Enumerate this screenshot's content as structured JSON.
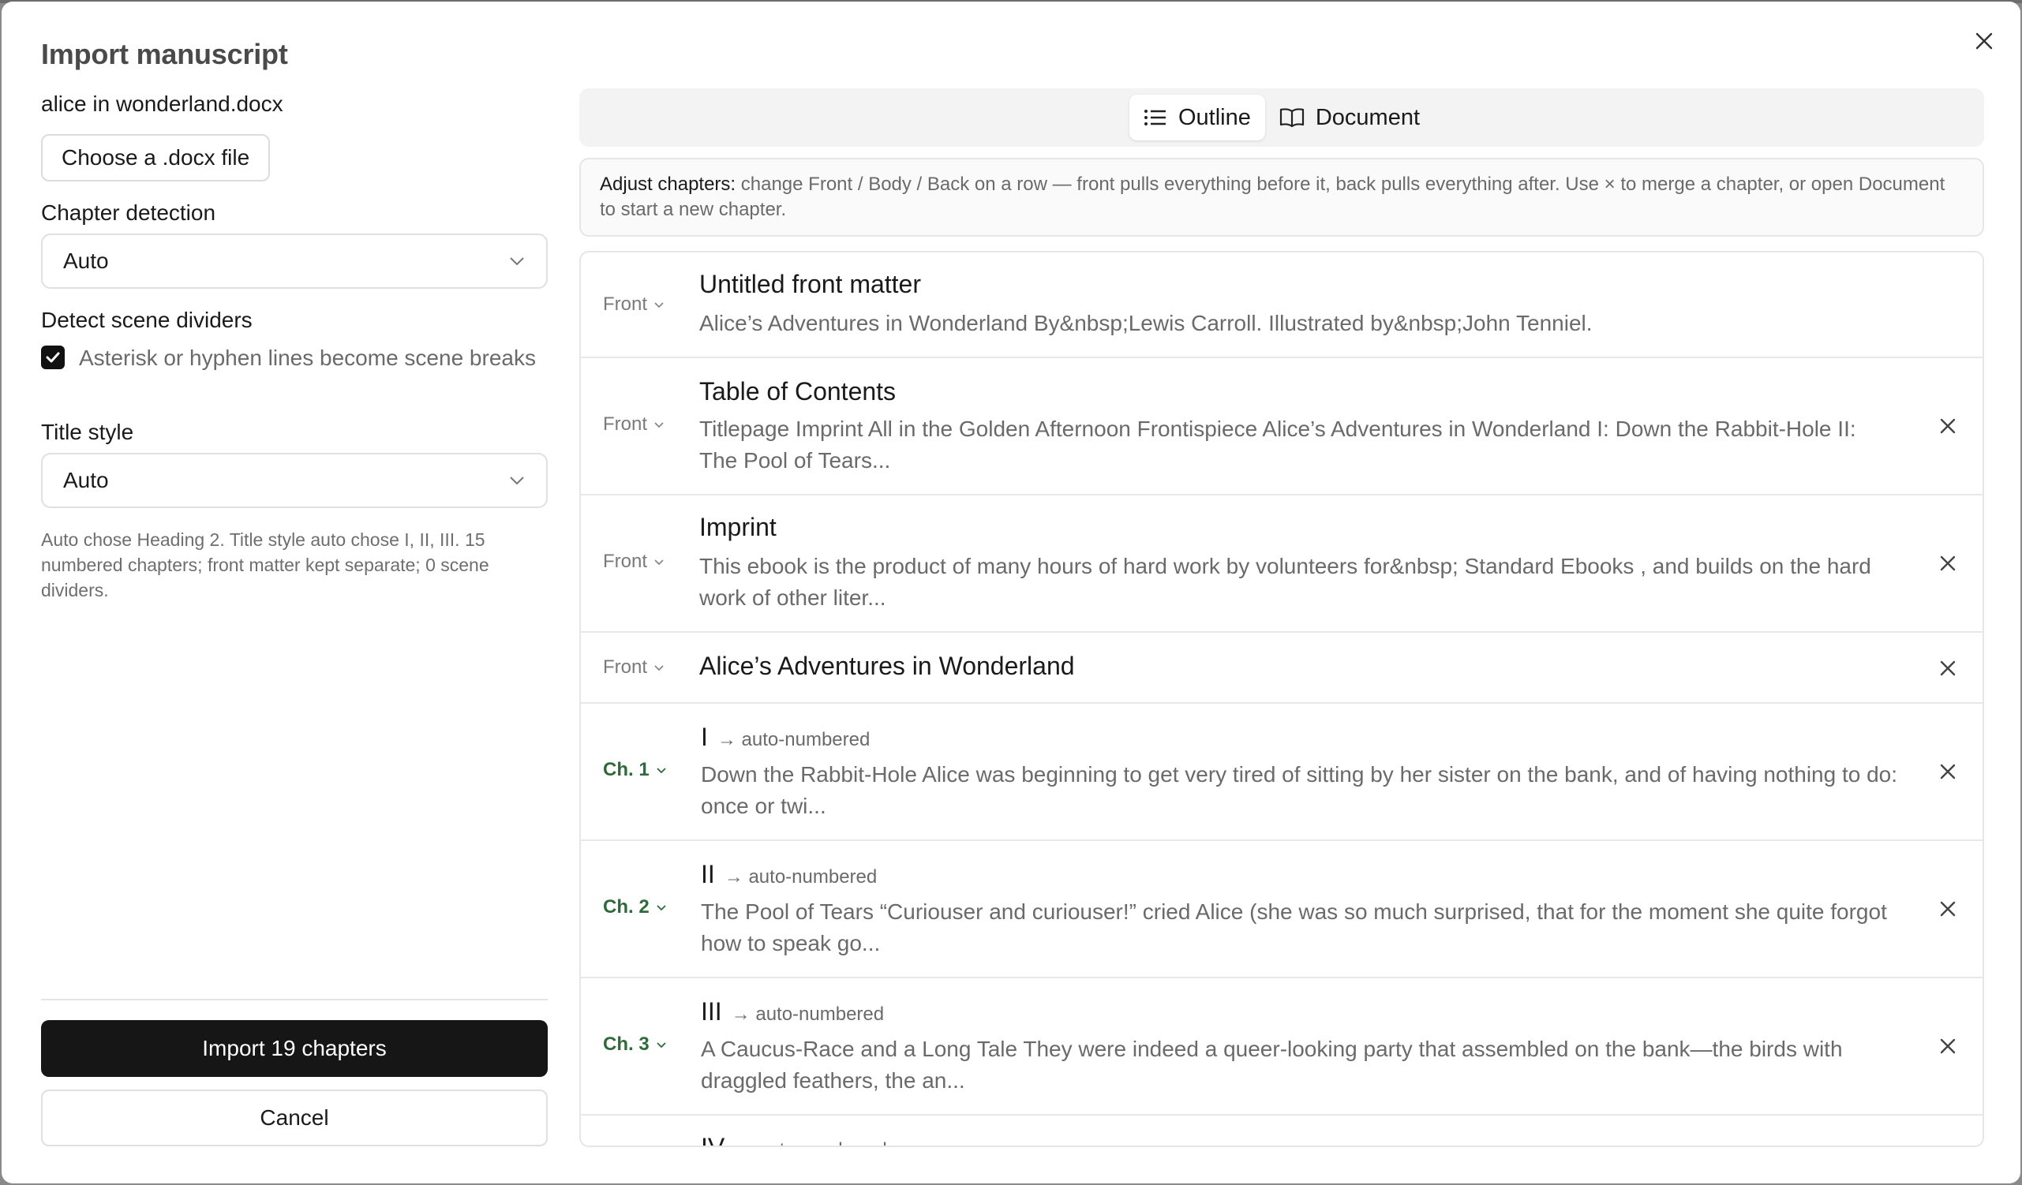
{
  "dialog": {
    "title": "Import manuscript",
    "close_icon": "close-icon"
  },
  "left": {
    "filename": "alice in wonderland.docx",
    "choose_button": "Choose a .docx file",
    "chapter_detection_label": "Chapter detection",
    "chapter_detection_value": "Auto",
    "scene_dividers_label": "Detect scene dividers",
    "scene_dividers_checkbox_label": "Asterisk or hyphen lines become scene breaks",
    "scene_dividers_checked": true,
    "title_style_label": "Title style",
    "title_style_value": "Auto",
    "summary": "Auto chose Heading 2. Title style auto chose I, II, III. 15 numbered chapters; front matter kept separate; 0 scene dividers.",
    "import_button": "Import 19 chapters",
    "cancel_button": "Cancel"
  },
  "tabs": [
    {
      "label": "Outline",
      "icon": "list-icon",
      "active": true
    },
    {
      "label": "Document",
      "icon": "book-open-icon",
      "active": false
    }
  ],
  "hint": {
    "strong": "Adjust chapters:",
    "text": " change Front / Body / Back on a row — front pulls everything before it, back pulls everything after. Use × to merge a chapter, or open Document to start a new chapter."
  },
  "rows": [
    {
      "kind": "Front",
      "title": "Untitled front matter",
      "auto": "",
      "desc": "Alice’s Adventures in Wonderland By&nbsp;Lewis Carroll. Illustrated by&nbsp;John Tenniel.",
      "removable": false
    },
    {
      "kind": "Front",
      "title": "Table of Contents",
      "auto": "",
      "desc": "Titlepage Imprint All in the Golden Afternoon Frontispiece Alice’s Adventures in Wonderland I: Down the Rabbit-Hole II: The Pool of Tears...",
      "removable": true
    },
    {
      "kind": "Front",
      "title": "Imprint",
      "auto": "",
      "desc": "This ebook is the product of many hours of hard work by volunteers for&nbsp; Standard Ebooks , and builds on the hard work of other liter...",
      "removable": true
    },
    {
      "kind": "Front",
      "title": "Alice’s Adventures in Wonderland",
      "auto": "",
      "desc": "",
      "removable": true
    },
    {
      "kind": "Ch. 1",
      "title": "I",
      "auto": "→ auto-numbered",
      "desc": "Down the Rabbit-Hole Alice was beginning to get very tired of sitting by her sister on the bank, and of having nothing to do: once or twi...",
      "removable": true
    },
    {
      "kind": "Ch. 2",
      "title": "II",
      "auto": "→ auto-numbered",
      "desc": "The Pool of Tears “Curiouser and curiouser!” cried Alice (she was so much surprised, that for the moment she quite forgot how to speak go...",
      "removable": true
    },
    {
      "kind": "Ch. 3",
      "title": "III",
      "auto": "→ auto-numbered",
      "desc": "A Caucus-Race and a Long Tale They were indeed a queer-looking party that assembled on the bank—the birds with draggled feathers, the an...",
      "removable": true
    },
    {
      "kind": "",
      "title": "IV",
      "auto": "→ auto-numbered",
      "desc": "",
      "removable": true
    }
  ]
}
